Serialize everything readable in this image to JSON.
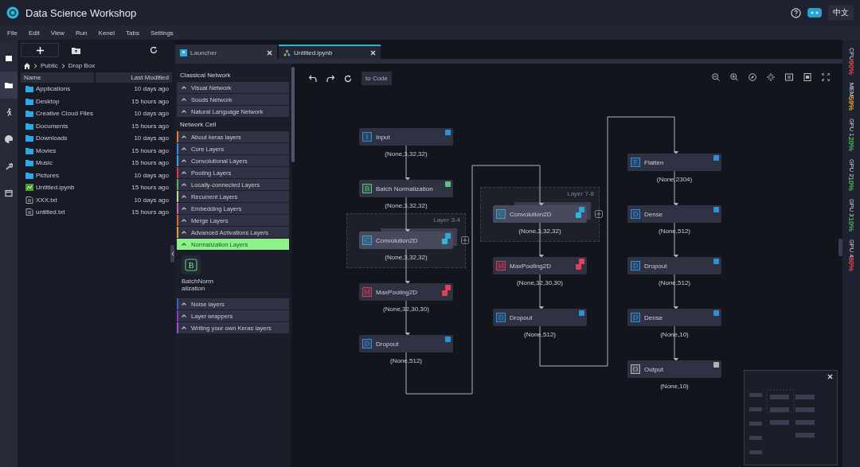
{
  "app": {
    "title": "Data Science Workshop",
    "language": "中文"
  },
  "menu": [
    "File",
    "Edit",
    "View",
    "Run",
    "Kenel",
    "Tabs",
    "Settings"
  ],
  "activity_bar": [
    {
      "kind": "file",
      "selected": false
    },
    {
      "kind": "folder",
      "selected": true
    },
    {
      "kind": "runner",
      "selected": false
    },
    {
      "kind": "palette",
      "selected": false
    },
    {
      "kind": "wrench",
      "selected": false
    },
    {
      "kind": "window",
      "selected": false
    }
  ],
  "file_browser": {
    "breadcrumb": [
      "Public",
      "Drop Box"
    ],
    "columns": [
      "Name",
      "Last Modified"
    ],
    "files": [
      {
        "name": "Applications",
        "modified": "10 days ago",
        "kind": "folder"
      },
      {
        "name": "Desktop",
        "modified": "15 hours ago",
        "kind": "folder"
      },
      {
        "name": "Creative Cloud Files",
        "modified": "10 days ago",
        "kind": "folder"
      },
      {
        "name": "Documents",
        "modified": "15 hours ago",
        "kind": "folder"
      },
      {
        "name": "Downloads",
        "modified": "10 days ago",
        "kind": "folder"
      },
      {
        "name": "Movies",
        "modified": "15 hours ago",
        "kind": "folder"
      },
      {
        "name": "Music",
        "modified": "15 hours ago",
        "kind": "folder"
      },
      {
        "name": "Pictures",
        "modified": "10 days ago",
        "kind": "folder"
      },
      {
        "name": "Untitled.ipynb",
        "modified": "15 hours ago",
        "kind": "notebook"
      },
      {
        "name": "XXX.txt",
        "modified": "10 days ago",
        "kind": "text"
      },
      {
        "name": "untitled.txt",
        "modified": "15 hours ago",
        "kind": "text"
      }
    ]
  },
  "tabs": [
    {
      "label": "Launcher",
      "selected": false,
      "kind": "launcher"
    },
    {
      "label": "Untitled.ipynb",
      "selected": true,
      "kind": "notebook"
    }
  ],
  "palette": {
    "sections": [
      {
        "title": "Classical Network",
        "items": [
          {
            "label": "Visual Network",
            "selected": false
          },
          {
            "label": "Souds Network",
            "selected": false
          },
          {
            "label": "Natural Language Network",
            "selected": false
          }
        ]
      },
      {
        "title": "Network Cell",
        "items": [
          {
            "label": "About keras layers",
            "selected": false,
            "color": "#d9822b"
          },
          {
            "label": "Core Layers",
            "selected": false,
            "color": "#2f8fd8"
          },
          {
            "label": "Convolutional Layers",
            "selected": false,
            "color": "#2fa7d8"
          },
          {
            "label": "Pooling Layers",
            "selected": false,
            "color": "#d83a55"
          },
          {
            "label": "Locally-connected Layers",
            "selected": false,
            "color": "#5fae5a"
          },
          {
            "label": "Recurrent Layers",
            "selected": false,
            "color": "#b6e08a"
          },
          {
            "label": "Embedding Layers",
            "selected": false,
            "color": "#c06ab0"
          },
          {
            "label": "Merge Layers",
            "selected": false,
            "color": "#d96a2b"
          },
          {
            "label": "Advanced Activations Layers",
            "selected": false,
            "color": "#e0a030"
          },
          {
            "label": "Normalization Layers",
            "selected": true,
            "color": "#8ef08a",
            "blocks": [
              {
                "icon": "B",
                "label": "BatchNormalization"
              }
            ]
          },
          {
            "label": "Noise layers",
            "selected": false,
            "color": "#3a5fd8"
          },
          {
            "label": "Layer wrappers",
            "selected": false,
            "color": "#8a3ab0"
          },
          {
            "label": "Writing your own Keras layers",
            "selected": false,
            "color": "#a050c8"
          }
        ]
      }
    ]
  },
  "toolbar": {
    "to_code": "to Code"
  },
  "graph": {
    "columns": [
      {
        "nodes": [
          {
            "kind": "input",
            "icon": "I",
            "label": "Input",
            "shape": "(None,3,32,32)"
          },
          {
            "kind": "normalization",
            "icon": "B",
            "label": "Batch Normalization",
            "shape": "(None,3,32,32)"
          },
          {
            "kind": "convolution",
            "icon": "C",
            "label": "Convolution2D",
            "shape": "(None,3,32,32)",
            "group": "Layer 3-4"
          },
          {
            "kind": "pooling",
            "icon": "M",
            "label": "MaxPooling2D",
            "shape": "(None,32,30,30)"
          },
          {
            "kind": "dropout",
            "icon": "D",
            "label": "Dropout",
            "shape": "(None,512)"
          }
        ]
      },
      {
        "nodes": [
          {
            "kind": "convolution",
            "icon": "C",
            "label": "Convolution2D",
            "shape": "(None,3,32,32)",
            "group": "Layer 7-8"
          },
          {
            "kind": "pooling",
            "icon": "M",
            "label": "MaxPooling2D",
            "shape": "(None,32,30,30)"
          },
          {
            "kind": "dropout",
            "icon": "D",
            "label": "Dropout",
            "shape": "(None,512)"
          }
        ]
      },
      {
        "nodes": [
          {
            "kind": "flatten",
            "icon": "F",
            "label": "Flatten",
            "shape": "(None,2304)"
          },
          {
            "kind": "dense",
            "icon": "D",
            "label": "Dense",
            "shape": "(None,512)"
          },
          {
            "kind": "dropout",
            "icon": "D",
            "label": "Dropout",
            "shape": "(None,512)"
          },
          {
            "kind": "dense",
            "icon": "D",
            "label": "Dense",
            "shape": "(None,10)"
          },
          {
            "kind": "output",
            "icon": "O",
            "label": "Output",
            "shape": "(None,10)"
          }
        ]
      }
    ]
  },
  "resources": [
    {
      "name": "CPU",
      "value": "90%",
      "color": "#e0474c"
    },
    {
      "name": "MEM",
      "value": "59%",
      "color": "#e0a030"
    },
    {
      "name": "GPU 1",
      "value": "20%",
      "color": "#4caf50"
    },
    {
      "name": "GPU 2",
      "value": "10%",
      "color": "#4caf50"
    },
    {
      "name": "GPU 3",
      "value": "10%",
      "color": "#4caf50"
    },
    {
      "name": "GPU 4",
      "value": "80%",
      "color": "#e0474c"
    }
  ]
}
